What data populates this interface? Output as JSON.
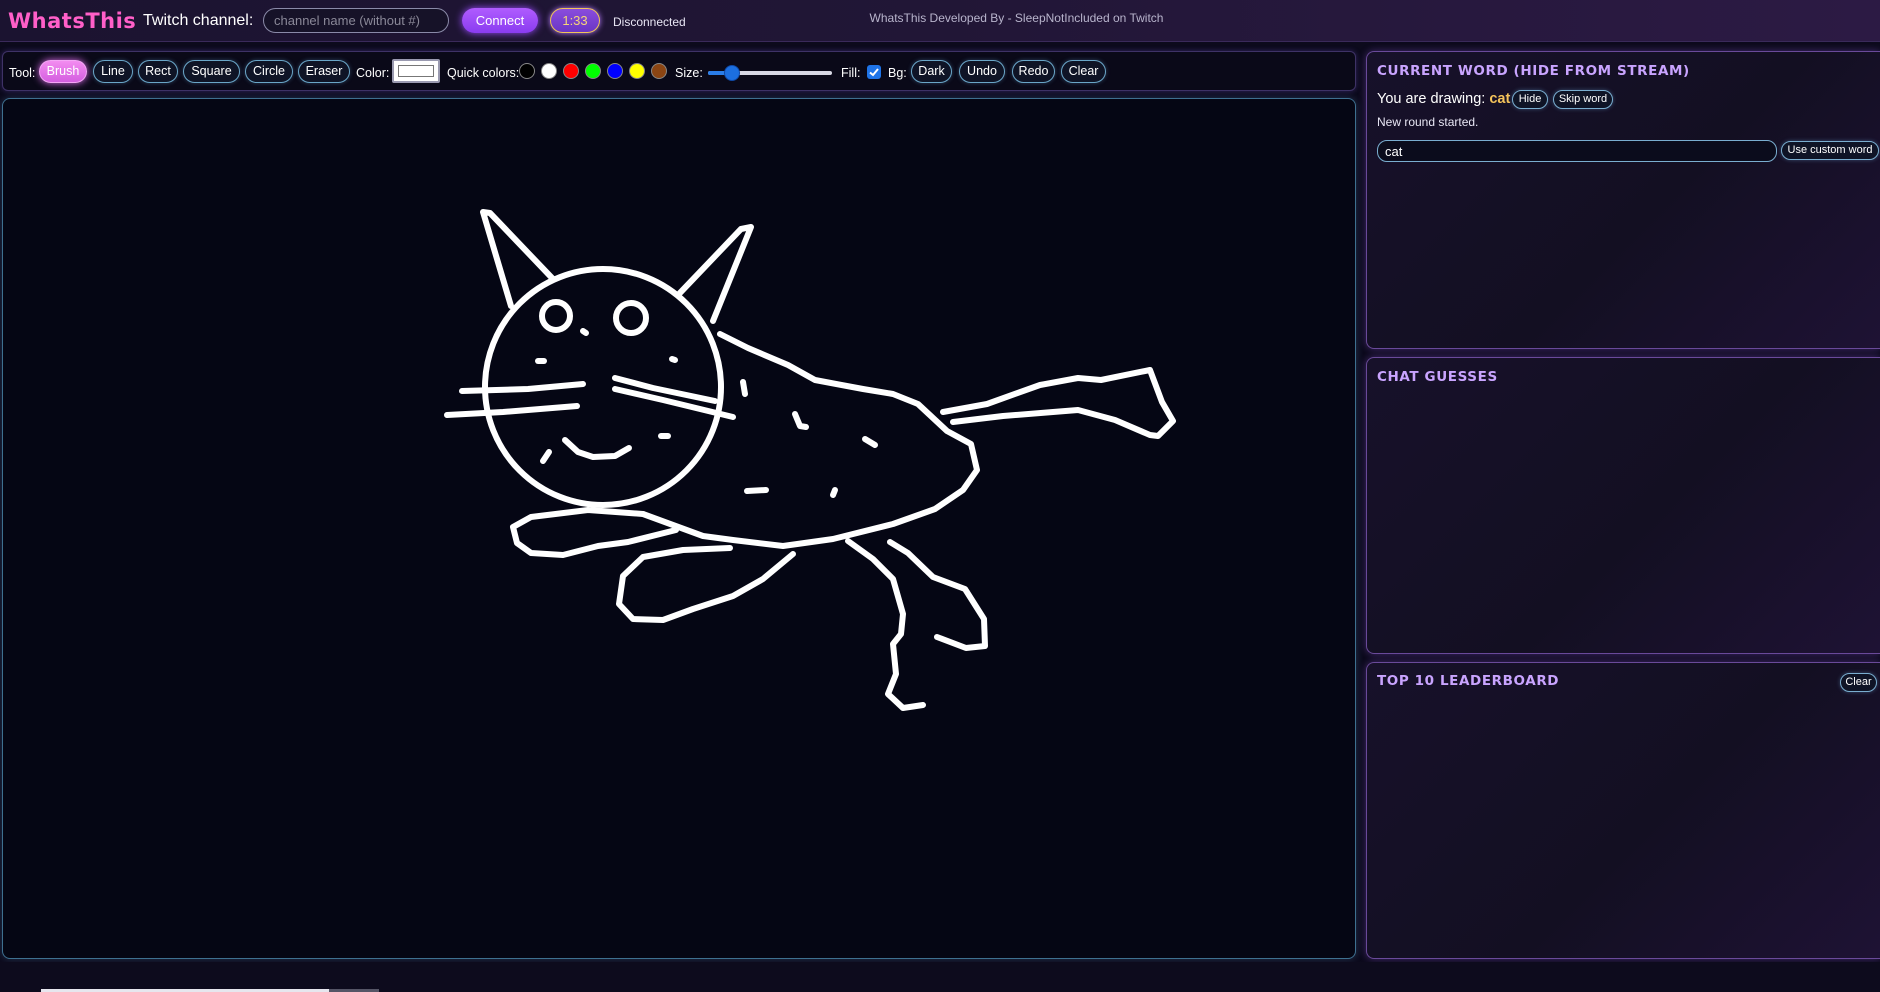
{
  "app": {
    "title": "WhatsThis"
  },
  "header": {
    "channel_label": "Twitch channel:",
    "channel_placeholder": "channel name (without #)",
    "channel_value": "",
    "connect_label": "Connect",
    "timer": "1:33",
    "status": "Disconnected"
  },
  "toolbar": {
    "tool_label": "Tool:",
    "tools": [
      "Brush",
      "Line",
      "Rect",
      "Square",
      "Circle",
      "Eraser"
    ],
    "active_tool": "Brush",
    "color_label": "Color:",
    "color_value": "#ffffff",
    "quick_colors_label": "Quick colors:",
    "quick_colors": [
      "#000000",
      "#ffffff",
      "#ff0000",
      "#00ff00",
      "#0000ff",
      "#ffff00",
      "#8b4513"
    ],
    "size_label": "Size:",
    "size_level": 0.15,
    "fill_label": "Fill:",
    "fill_checked": true,
    "bg_label": "Bg:",
    "bg_button": "Dark",
    "undo_label": "Undo",
    "redo_label": "Redo",
    "clear_label": "Clear"
  },
  "canvas": {
    "drawing_icon": "cat-doodle",
    "stroke_color": "#ffffff"
  },
  "current_word": {
    "title": "CURRENT WORD (HIDE FROM STREAM)",
    "drawing_prefix": "You are drawing:",
    "word": "cat",
    "hide_label": "Hide",
    "skip_label": "Skip word",
    "message": "New round started.",
    "input_value": "cat",
    "use_custom_label": "Use custom word"
  },
  "chat_guesses": {
    "title": "CHAT GUESSES"
  },
  "leaderboard": {
    "title": "TOP 10 LEADERBOARD",
    "clear_label": "Clear"
  },
  "footer": {
    "text": "WhatsThis Developed By - SleepNotIncluded on Twitch"
  },
  "colors": {
    "accent": "#ff5fc8",
    "panel_title": "#c9a4ff",
    "word": "#f4c35a",
    "connect": "#9b4dff"
  }
}
